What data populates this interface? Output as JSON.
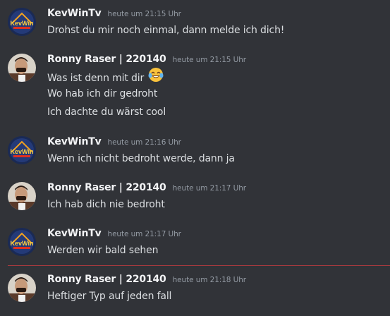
{
  "messages": [
    {
      "author": "KevWinTv",
      "timestamp": "heute um 21:15 Uhr",
      "avatar": "kevwintv-avatar",
      "lines": [
        "Drohst du mir noch einmal, dann melde ich dich!"
      ]
    },
    {
      "author": "Ronny Raser | 220140",
      "timestamp": "heute um 21:15 Uhr",
      "avatar": "ronny-raser-avatar",
      "lines": [
        "Was ist denn mit dir",
        "Wo hab ich dir gedroht",
        "Ich dachte du wärst cool"
      ],
      "emoji": "face-with-tears-of-joy-emoji"
    },
    {
      "author": "KevWinTv",
      "timestamp": "heute um 21:16 Uhr",
      "avatar": "kevwintv-avatar",
      "lines": [
        "Wenn ich nicht bedroht werde, dann ja"
      ]
    },
    {
      "author": "Ronny Raser | 220140",
      "timestamp": "heute um 21:17 Uhr",
      "avatar": "ronny-raser-avatar",
      "lines": [
        "Ich hab dich nie bedroht"
      ]
    },
    {
      "author": "KevWinTv",
      "timestamp": "heute um 21:17 Uhr",
      "avatar": "kevwintv-avatar",
      "lines": [
        "Werden wir bald sehen"
      ]
    },
    {
      "author": "Ronny Raser | 220140",
      "timestamp": "heute um 21:18 Uhr",
      "avatar": "ronny-raser-avatar",
      "lines": [
        "Heftiger Typ auf jeden fall"
      ]
    }
  ],
  "colors": {
    "background": "#313338",
    "username": "#f2f3f5",
    "text": "#dbdee1",
    "timestamp": "#949ba4",
    "new_divider": "#a6393e"
  }
}
